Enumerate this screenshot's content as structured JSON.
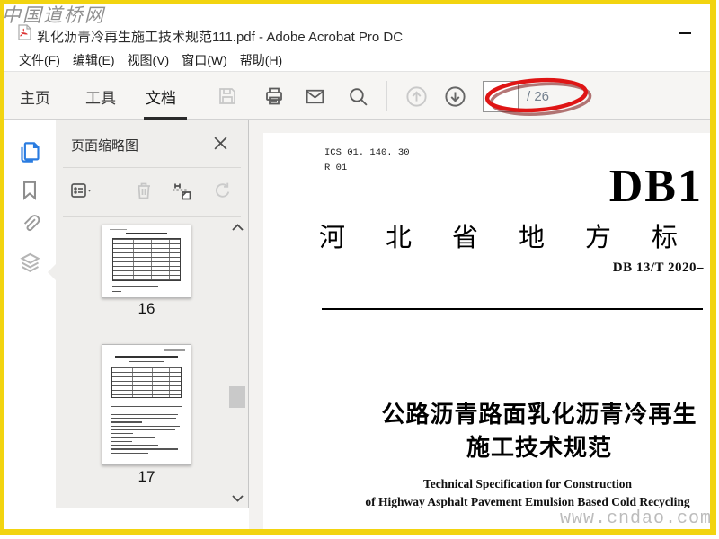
{
  "window": {
    "title": "乳化沥青冷再生施工技术规范111.pdf - Adobe Acrobat Pro DC"
  },
  "watermarks": {
    "top_left": "中国道桥网",
    "bottom_right": "www.cndao.com"
  },
  "menu": {
    "items": [
      "文件(F)",
      "编辑(E)",
      "视图(V)",
      "窗口(W)",
      "帮助(H)"
    ]
  },
  "toolbar": {
    "tabs": [
      "主页",
      "工具",
      "文档"
    ],
    "active_tab": "文档",
    "page_input_value": "",
    "page_total_label": "/ 26"
  },
  "sidebar_icons": [
    "page-thumbnails",
    "bookmarks",
    "attachments",
    "layers"
  ],
  "panel": {
    "title": "页面缩略图",
    "page_labels": [
      "16",
      "17"
    ]
  },
  "document": {
    "ics_line1": "ICS 01. 140. 30",
    "ics_line2": "R 01",
    "db_big": "DB1",
    "province_spaced": "河　北　省　地　方　标",
    "standard_code": "DB 13/T  2020–",
    "title_line1": "公路沥青路面乳化沥青冷再生",
    "title_line2": "施工技术规范",
    "en_line1": "Technical Specification for Construction",
    "en_line2": "of Highway Asphalt Pavement Emulsion Based Cold Recycling"
  },
  "colors": {
    "frame_yellow": "#f2d410",
    "annotation_red": "#df1515",
    "active_panel_blue": "#2a7ce0"
  }
}
